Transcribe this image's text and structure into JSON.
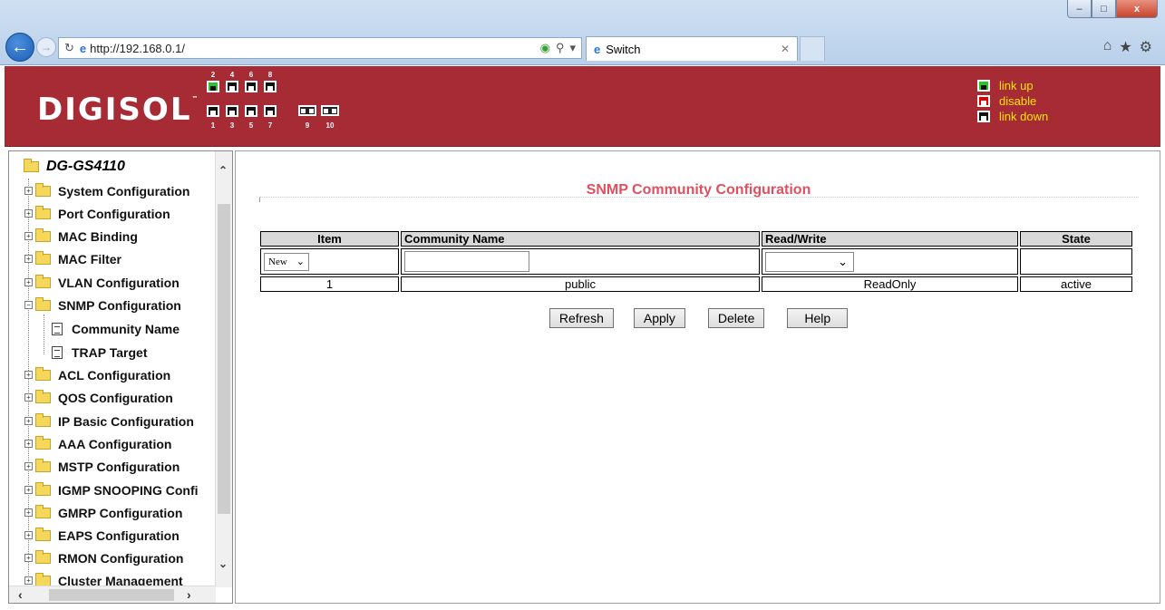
{
  "browser": {
    "url": "http://192.168.0.1/",
    "tab_title": "Switch",
    "window_buttons": {
      "minimize": "–",
      "maximize": "□",
      "close": "x"
    },
    "toolbar_icons": [
      "home-icon",
      "star-icon",
      "gear-icon"
    ]
  },
  "header": {
    "logo": "DIGISOL",
    "logo_tm": "™",
    "ports_top_labels": [
      "2",
      "4",
      "6",
      "8"
    ],
    "ports_bottom_labels": [
      "1",
      "3",
      "5",
      "7",
      "9",
      "10"
    ],
    "port_states": {
      "2": "link up",
      "1": "link down",
      "3": "link down",
      "4": "link down",
      "5": "link down",
      "6": "link down",
      "7": "link down",
      "8": "link down"
    },
    "legend": [
      "link up",
      "disable",
      "link down"
    ],
    "colors": {
      "banner": "#a62b35",
      "legend_text": "#ffe400",
      "link_up": "#2fc22f",
      "disable": "#e00000",
      "link_down": "#111111"
    }
  },
  "sidebar": {
    "root": "DG-GS4110",
    "items": [
      "System Configuration",
      "Port Configuration",
      "MAC Binding",
      "MAC Filter",
      "VLAN Configuration",
      "SNMP Configuration",
      "Community Name",
      "TRAP Target",
      "ACL Configuration",
      "QOS Configuration",
      "IP Basic Configuration",
      "AAA Configuration",
      "MSTP Configuration",
      "IGMP SNOOPING Confi",
      "GMRP Configuration",
      "EAPS Configuration",
      "RMON Configuration",
      "Cluster Management"
    ]
  },
  "main": {
    "title": "SNMP Community Configuration",
    "table": {
      "headers": [
        "Item",
        "Community Name",
        "Read/Write",
        "State"
      ],
      "new_row": {
        "item_select": "New",
        "community_name": "",
        "read_write": ""
      },
      "rows": [
        {
          "item": "1",
          "community_name": "public",
          "read_write": "ReadOnly",
          "state": "active"
        }
      ]
    },
    "buttons": {
      "refresh": "Refresh",
      "apply": "Apply",
      "delete": "Delete",
      "help": "Help"
    }
  }
}
